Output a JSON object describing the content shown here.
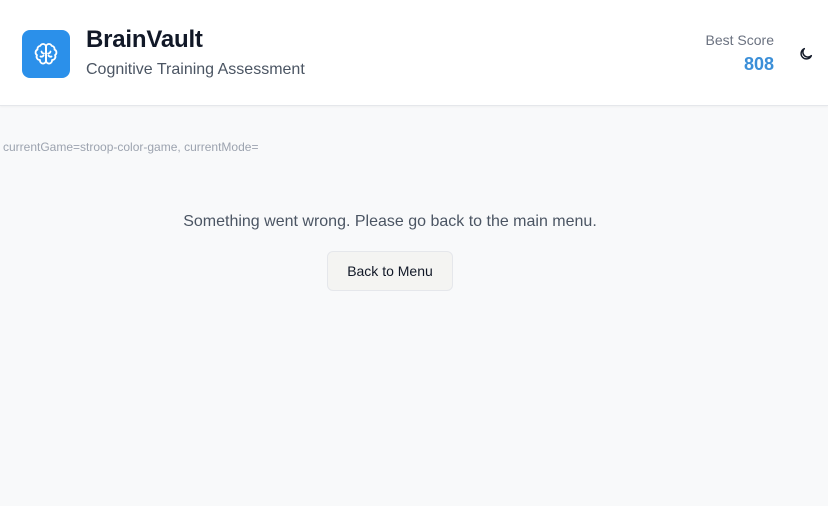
{
  "header": {
    "title": "BrainVault",
    "subtitle": "Cognitive Training Assessment",
    "logo_icon": "brain-icon",
    "best_score_label": "Best Score",
    "best_score_value": "808",
    "theme_icon": "moon-icon"
  },
  "debug": {
    "text": "currentGame=stroop-color-game, currentMode="
  },
  "main": {
    "error_message": "Something went wrong. Please go back to the main menu.",
    "back_button_label": "Back to Menu"
  },
  "colors": {
    "accent": "#2b90ea",
    "score": "#3b8fd8",
    "background": "#f8f9fa"
  }
}
